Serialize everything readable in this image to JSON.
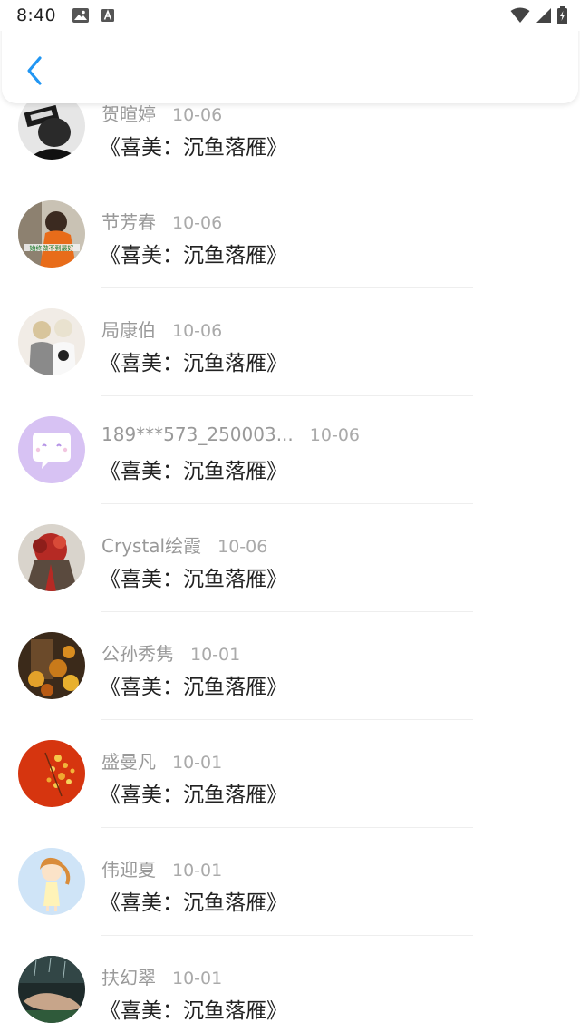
{
  "status_bar": {
    "time": "8:40",
    "left_icons": [
      "image-icon",
      "text-a-icon"
    ],
    "right_icons": [
      "wifi-icon",
      "signal-icon",
      "battery-icon"
    ]
  },
  "header": {
    "back_icon": "chevron-left-icon",
    "accent_color": "#2196F3"
  },
  "comments": [
    {
      "name": "贺暄婷",
      "date": "10-06",
      "title": "《喜美：沉鱼落雁》",
      "avatar": "dark-portrait"
    },
    {
      "name": "节芳春",
      "date": "10-06",
      "title": "《喜美：沉鱼落雁》",
      "avatar": "orange-portrait"
    },
    {
      "name": "局康伯",
      "date": "10-06",
      "title": "《喜美：沉鱼落雁》",
      "avatar": "couple-photo"
    },
    {
      "name": "189***573_250003...",
      "date": "10-06",
      "title": "《喜美：沉鱼落雁》",
      "avatar": "chat-bubble-default"
    },
    {
      "name": "Crystal绘霞",
      "date": "10-06",
      "title": "《喜美：沉鱼落雁》",
      "avatar": "red-flowers"
    },
    {
      "name": "公孙秀隽",
      "date": "10-01",
      "title": "《喜美：沉鱼落雁》",
      "avatar": "autumn-leaves"
    },
    {
      "name": "盛曼凡",
      "date": "10-01",
      "title": "《喜美：沉鱼落雁》",
      "avatar": "red-yellow-blossoms"
    },
    {
      "name": "伟迎夏",
      "date": "10-01",
      "title": "《喜美：沉鱼落雁》",
      "avatar": "cartoon-girl"
    },
    {
      "name": "扶幻翠",
      "date": "10-01",
      "title": "《喜美：沉鱼落雁》",
      "avatar": "hand-rain"
    }
  ]
}
